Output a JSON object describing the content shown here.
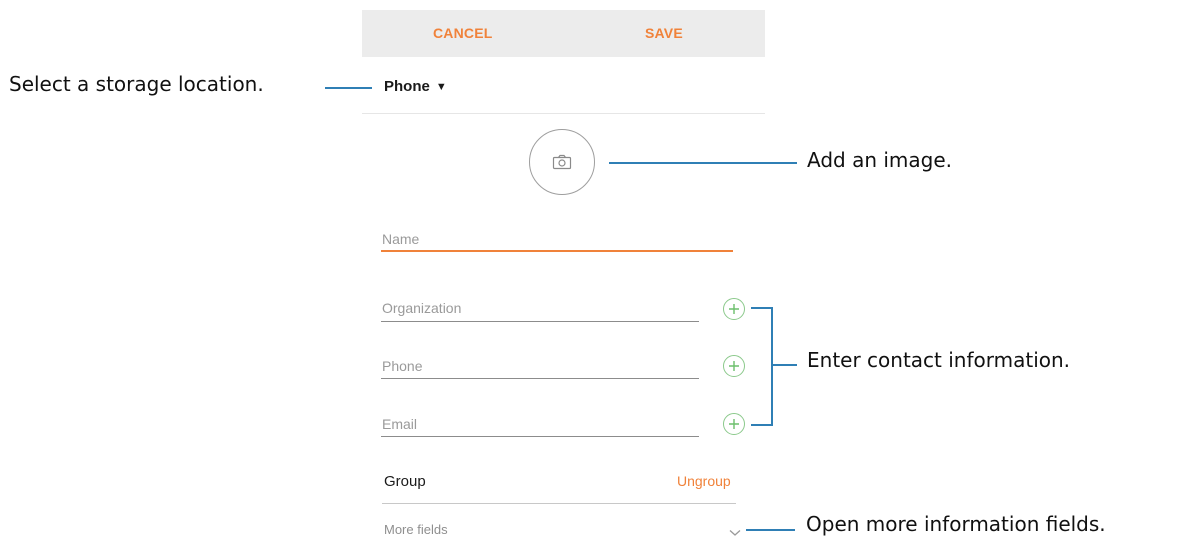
{
  "header": {
    "cancel_label": "CANCEL",
    "save_label": "SAVE"
  },
  "storage": {
    "label": "Phone",
    "caret": "▼"
  },
  "photo": {
    "icon": "camera-icon"
  },
  "fields": {
    "name_placeholder": "Name",
    "organization_placeholder": "Organization",
    "phone_placeholder": "Phone",
    "email_placeholder": "Email",
    "add_icon": "plus-circle-icon"
  },
  "group": {
    "label": "Group",
    "value": "Ungroup"
  },
  "more_fields": {
    "label": "More fields",
    "icon": "chevron-down-icon"
  },
  "callouts": {
    "storage": "Select a storage location.",
    "image": "Add an image.",
    "contact": "Enter contact information.",
    "more": "Open more information fields."
  },
  "colors": {
    "accent": "#f0823a",
    "plus": "#6cbf6c",
    "callout_line": "#2f7fb5",
    "bar": "#ececec"
  }
}
